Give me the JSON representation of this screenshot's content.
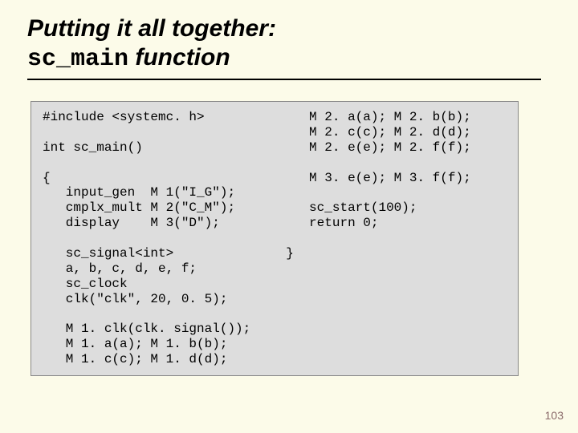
{
  "title_line1": "Putting it all together:",
  "title_kw": "sc_main",
  "title_line2_suffix": " function",
  "code_left": "#include <systemc. h>\n\nint sc_main()\n\n{\n   input_gen  M 1(\"I_G\");\n   cmplx_mult M 2(\"C_M\");\n   display    M 3(\"D\");\n\n   sc_signal<int>\n   a, b, c, d, e, f;\n   sc_clock\n   clk(\"clk\", 20, 0. 5);\n\n   M 1. clk(clk. signal());\n   M 1. a(a); M 1. b(b);\n   M 1. c(c); M 1. d(d);",
  "code_right": "   M 2. a(a); M 2. b(b);\n   M 2. c(c); M 2. d(d);\n   M 2. e(e); M 2. f(f);\n\n   M 3. e(e); M 3. f(f);\n\n   sc_start(100);\n   return 0;\n\n}",
  "page_number": "103"
}
